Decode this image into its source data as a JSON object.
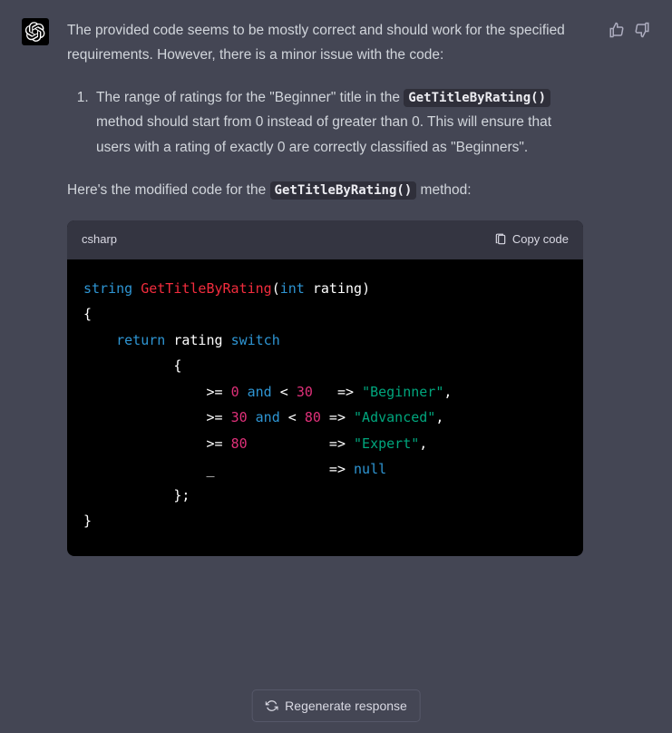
{
  "message": {
    "intro": "The provided code seems to be mostly correct and should work for the specified requirements. However, there is a minor issue with the code:",
    "list_item": {
      "text_before": "The range of ratings for the \"Beginner\" title in the ",
      "code": "GetTitleByRating()",
      "text_after": " method should start from 0 instead of greater than 0. This will ensure that users with a rating of exactly 0 are correctly classified as \"Beginners\"."
    },
    "outro_before": "Here's the modified code for the ",
    "outro_code": "GetTitleByRating()",
    "outro_after": " method:"
  },
  "code_block": {
    "language": "csharp",
    "copy_label": "Copy code",
    "tokens": {
      "t_string": "string",
      "t_fn": "GetTitleByRating",
      "t_int": "int",
      "t_param": "rating",
      "t_return": "return",
      "t_switch": "switch",
      "t_and": "and",
      "t_null": "null",
      "n0": "0",
      "n30": "30",
      "n80": "80",
      "s_beg": "\"Beginner\"",
      "s_adv": "\"Advanced\"",
      "s_exp": "\"Expert\""
    }
  },
  "regenerate_label": "Regenerate response"
}
